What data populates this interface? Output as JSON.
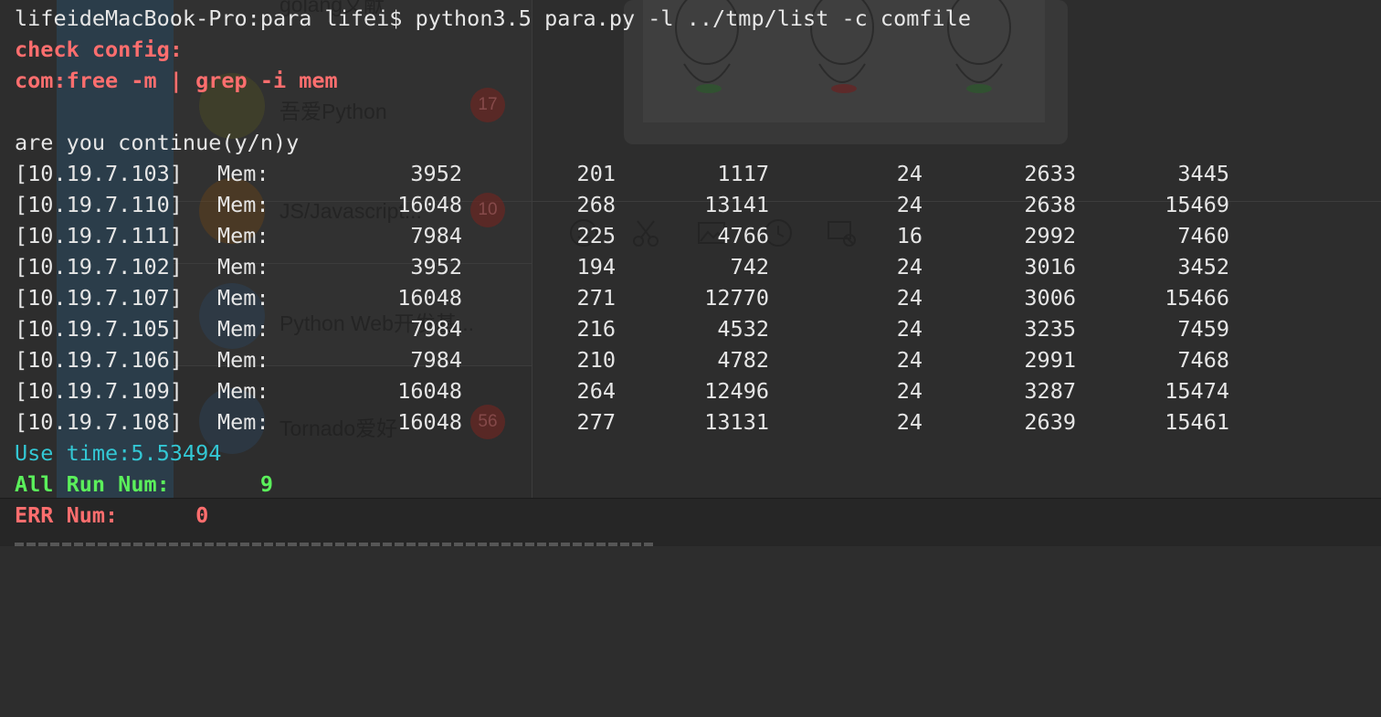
{
  "prompt_line": "lifeideMacBook-Pro:para lifei$ python3.5 para.py -l ../tmp/list -c comfile",
  "check_config": "check config:",
  "com_line": "com:free -m | grep -i mem",
  "continue_prompt": "are you continue(y/n)y",
  "rows": [
    {
      "host": "[10.19.7.103]",
      "label": "Mem:",
      "v1": "3952",
      "v2": "201",
      "v3": "1117",
      "v4": "24",
      "v5": "2633",
      "v6": "3445"
    },
    {
      "host": "[10.19.7.110]",
      "label": "Mem:",
      "v1": "16048",
      "v2": "268",
      "v3": "13141",
      "v4": "24",
      "v5": "2638",
      "v6": "15469"
    },
    {
      "host": "[10.19.7.111]",
      "label": "Mem:",
      "v1": "7984",
      "v2": "225",
      "v3": "4766",
      "v4": "16",
      "v5": "2992",
      "v6": "7460"
    },
    {
      "host": "[10.19.7.102]",
      "label": "Mem:",
      "v1": "3952",
      "v2": "194",
      "v3": "742",
      "v4": "24",
      "v5": "3016",
      "v6": "3452"
    },
    {
      "host": "[10.19.7.107]",
      "label": "Mem:",
      "v1": "16048",
      "v2": "271",
      "v3": "12770",
      "v4": "24",
      "v5": "3006",
      "v6": "15466"
    },
    {
      "host": "[10.19.7.105]",
      "label": "Mem:",
      "v1": "7984",
      "v2": "216",
      "v3": "4532",
      "v4": "24",
      "v5": "3235",
      "v6": "7459"
    },
    {
      "host": "[10.19.7.106]",
      "label": "Mem:",
      "v1": "7984",
      "v2": "210",
      "v3": "4782",
      "v4": "24",
      "v5": "2991",
      "v6": "7468"
    },
    {
      "host": "[10.19.7.109]",
      "label": "Mem:",
      "v1": "16048",
      "v2": "264",
      "v3": "12496",
      "v4": "24",
      "v5": "3287",
      "v6": "15474"
    },
    {
      "host": "[10.19.7.108]",
      "label": "Mem:",
      "v1": "16048",
      "v2": "277",
      "v3": "13131",
      "v4": "24",
      "v5": "2639",
      "v6": "15461"
    }
  ],
  "use_time": "Use time:5.53494",
  "all_run": "All Run Num:       9",
  "err_num": "ERR Num:      0",
  "background": {
    "list_items": [
      "golang文献",
      "吾爱Python",
      "JS/Javascript...",
      "Python Web开发基...",
      "Tornado爱好"
    ],
    "badges": [
      "17",
      "10",
      "56"
    ],
    "toolbar_icons": [
      "emoji-icon",
      "scissors-icon",
      "image-icon",
      "clock-icon",
      "chat-off-icon"
    ]
  },
  "colors": {
    "terminal_bg": "#2d2d2d",
    "text": "#e6e6e6",
    "red": "#ff6e6e",
    "cyan": "#33c7d4",
    "green": "#5bf05b"
  }
}
